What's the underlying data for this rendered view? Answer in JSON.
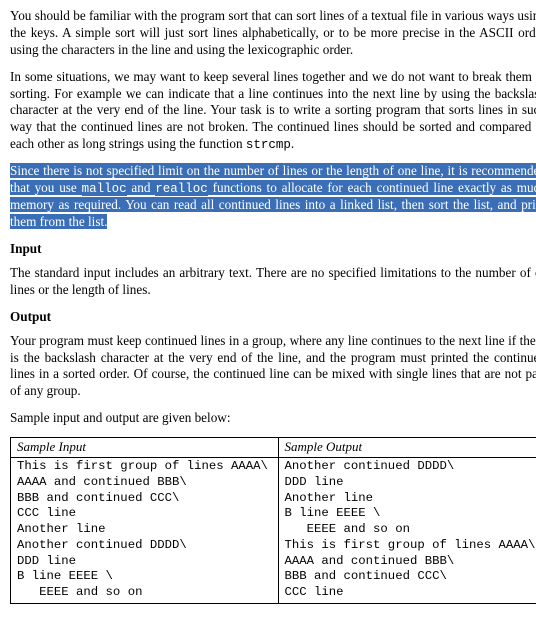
{
  "paragraphs": {
    "p1": "You should be familiar with the program sort that can sort lines of a textual file in various ways using the keys. A simple sort will just sort lines alphabetically, or to be more precise in the ASCII order using the characters in the line and using the lexicographic order.",
    "p2": "In some situations, we may want to keep several lines together and we do not want to break them in sorting. For example we can indicate that a line continues into the next line by using the backslash character at the very end of the line. Your task is to write a sorting program that sorts lines in such way that the continued lines are not broken. The continued lines should be sorted and compared to each other as long strings using the function ",
    "p2_code": "strcmp",
    "p2_tail": ".",
    "p3_a": "Since there is not specified limit on the number of lines or the length of one line, it is recommended that you use ",
    "p3_code1": "malloc",
    "p3_mid": " and ",
    "p3_code2": "realloc",
    "p3_b": " functions to allocate for each continued line exactly as much memory as required.",
    "p3_c": " You can read all continued lines into a linked list, then sort the list, and print them from the list.",
    "h_input": "Input",
    "p_input": "The standard input includes an arbitrary text. There are no specified limitations to the number of of lines or the length of lines.",
    "h_output": "Output",
    "p_output": "Your program must keep continued lines in a group, where any line continues to the next line if there is the backslash character at the very end of the line, and the program must printed the continued lines in a sorted order. Of course, the continued line can be mixed with single lines that are not part of any group.",
    "p_sample_intro": "Sample input and output are given below:"
  },
  "table": {
    "header_in": "Sample Input",
    "header_out": "Sample Output",
    "input_lines": [
      "This is first group of lines AAAA\\",
      "AAAA and continued BBB\\",
      "BBB and continued CCC\\",
      "CCC line",
      "Another line",
      "Another continued DDDD\\",
      "DDD line",
      "B line EEEE \\",
      "   EEEE and so on"
    ],
    "output_lines": [
      "Another continued DDDD\\",
      "DDD line",
      "Another line",
      "B line EEEE \\",
      "   EEEE and so on",
      "This is first group of lines AAAA\\",
      "AAAA and continued BBB\\",
      "BBB and continued CCC\\",
      "CCC line"
    ]
  }
}
